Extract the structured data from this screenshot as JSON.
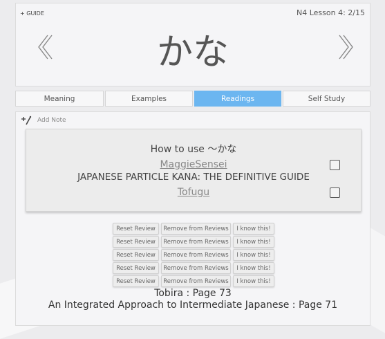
{
  "header": {
    "guide_label": "+ GUIDE",
    "lesson": "N4 Lesson 4: 2/15",
    "word": "かな"
  },
  "nav": {
    "prev_icon": "chevron-left-double-icon",
    "next_icon": "chevron-right-double-icon"
  },
  "tabs": [
    {
      "label": "Meaning",
      "active": false
    },
    {
      "label": "Examples",
      "active": false
    },
    {
      "label": "Readings",
      "active": true
    },
    {
      "label": "Self Study",
      "active": false
    }
  ],
  "notes": {
    "add_note_label": "Add Note",
    "icon": "add-note-icon"
  },
  "readings": {
    "title": "How to use 〜かな",
    "items": [
      {
        "label": "MaggieSensei",
        "link": true
      },
      {
        "label": "JAPANESE PARTICLE KANA: THE DEFINITIVE GUIDE",
        "link": false
      },
      {
        "label": "Tofugu",
        "link": true
      }
    ]
  },
  "review_rows": [
    {
      "reset": "Reset Review",
      "remove": "Remove from Reviews",
      "know": "I know this!"
    },
    {
      "reset": "Reset Review",
      "remove": "Remove from Reviews",
      "know": "I know this!"
    },
    {
      "reset": "Reset Review",
      "remove": "Remove from Reviews",
      "know": "I know this!"
    },
    {
      "reset": "Reset Review",
      "remove": "Remove from Reviews",
      "know": "I know this!"
    },
    {
      "reset": "Reset Review",
      "remove": "Remove from Reviews",
      "know": "I know this!"
    }
  ],
  "page_refs": [
    "Tobira : Page 73",
    "An Integrated Approach to Intermediate Japanese : Page 71"
  ],
  "colors": {
    "active_tab": "#6cb6f0",
    "card_bg": "#f5f5f7"
  }
}
